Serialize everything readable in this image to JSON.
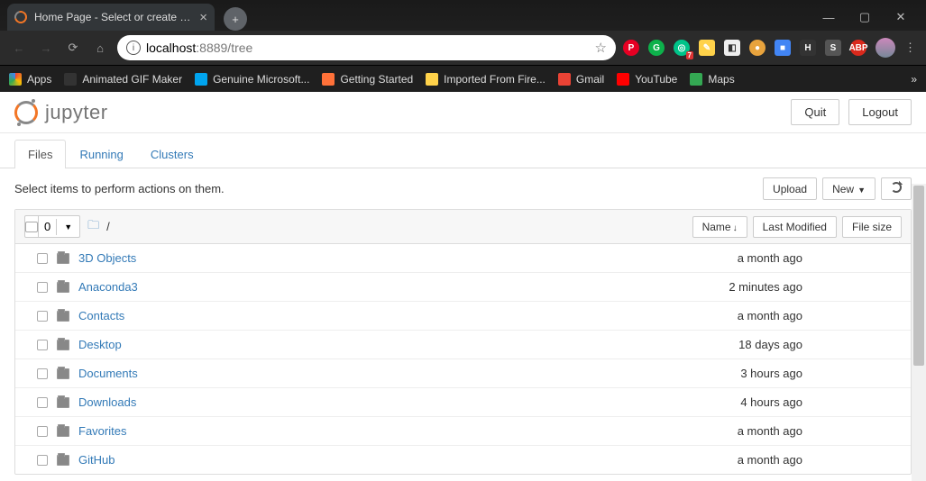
{
  "browser": {
    "tab_title": "Home Page - Select or create a n",
    "new_tab_glyph": "+",
    "tab_close_glyph": "×",
    "url_host": "localhost",
    "url_port_path": ":8889/tree",
    "win_min": "—",
    "win_max": "▢",
    "win_close": "✕",
    "menu_dots": "⋮",
    "star": "☆",
    "ext_badge_7": "7",
    "more_bookmarks": "»"
  },
  "bookmarks": [
    {
      "label": "Apps",
      "color": "#888"
    },
    {
      "label": "Animated GIF Maker",
      "color": "#333"
    },
    {
      "label": "Genuine Microsoft...",
      "color": "#00a4ef"
    },
    {
      "label": "Getting Started",
      "color": "#ff7139"
    },
    {
      "label": "Imported From Fire...",
      "color": "#ffd24a"
    },
    {
      "label": "Gmail",
      "color": "#ea4335"
    },
    {
      "label": "YouTube",
      "color": "#ff0000"
    },
    {
      "label": "Maps",
      "color": "#34a853"
    }
  ],
  "jupyter": {
    "logo_text": "jupyter",
    "quit": "Quit",
    "logout": "Logout",
    "tabs": {
      "files": "Files",
      "running": "Running",
      "clusters": "Clusters"
    },
    "hint": "Select items to perform actions on them.",
    "upload": "Upload",
    "new": "New",
    "refresh_title": "Refresh",
    "sel_count": "0",
    "crumb_root": "/",
    "cols": {
      "name": "Name",
      "last_modified": "Last Modified",
      "file_size": "File size"
    },
    "items": [
      {
        "name": "3D Objects",
        "modified": "a month ago"
      },
      {
        "name": "Anaconda3",
        "modified": "2 minutes ago"
      },
      {
        "name": "Contacts",
        "modified": "a month ago"
      },
      {
        "name": "Desktop",
        "modified": "18 days ago"
      },
      {
        "name": "Documents",
        "modified": "3 hours ago"
      },
      {
        "name": "Downloads",
        "modified": "4 hours ago"
      },
      {
        "name": "Favorites",
        "modified": "a month ago"
      },
      {
        "name": "GitHub",
        "modified": "a month ago"
      }
    ]
  }
}
